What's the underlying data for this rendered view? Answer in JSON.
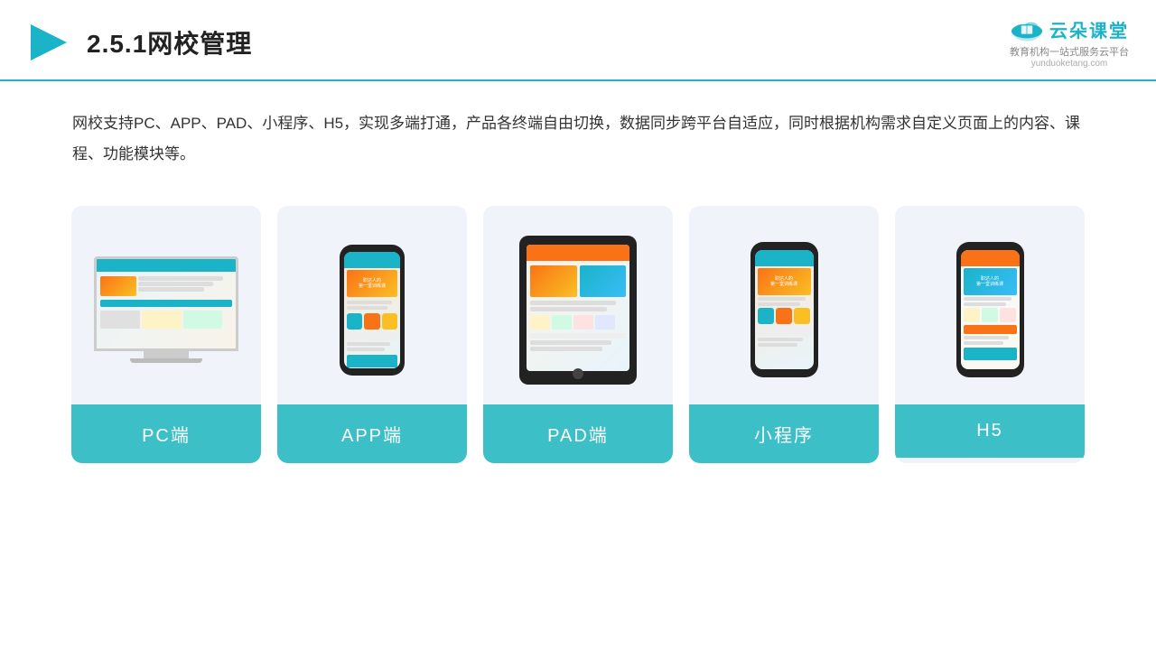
{
  "header": {
    "title": "2.5.1网校管理",
    "logo_main": "云朵课堂",
    "logo_sub": "教育机构一站\n式服务云平台",
    "logo_url": "yunduoketang.com"
  },
  "description": {
    "text": "网校支持PC、APP、PAD、小程序、H5，实现多端打通，产品各终端自由切换，数据同步跨平台自适应，同时根据机构需求自定义页面上的内容、课程、功能模块等。"
  },
  "cards": [
    {
      "id": "pc",
      "label": "PC端"
    },
    {
      "id": "app",
      "label": "APP端"
    },
    {
      "id": "pad",
      "label": "PAD端"
    },
    {
      "id": "miniprogram",
      "label": "小程序"
    },
    {
      "id": "h5",
      "label": "H5"
    }
  ],
  "colors": {
    "accent": "#1ab3c8",
    "card_bg": "#f0f4fa",
    "card_label_bg": "#3dbfc8",
    "header_border": "#1ab3c8"
  }
}
